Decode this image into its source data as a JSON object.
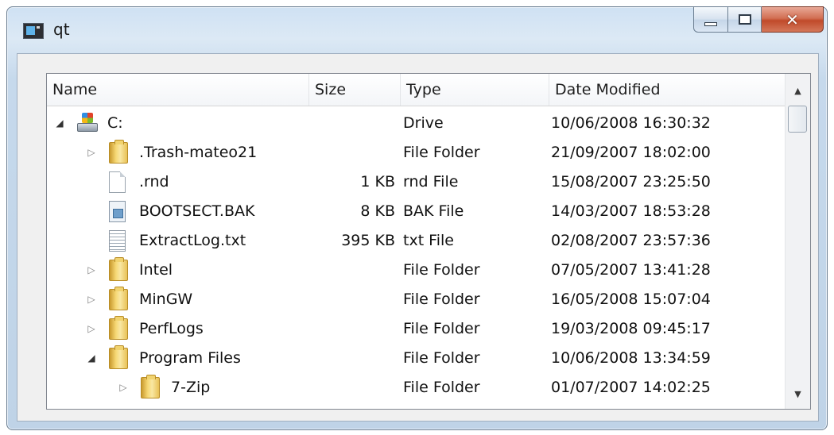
{
  "window": {
    "title": "qt"
  },
  "columns": [
    "Name",
    "Size",
    "Type",
    "Date Modified"
  ],
  "rows": [
    {
      "name": "C:",
      "size": "",
      "type": "Drive",
      "date": "10/06/2008 16:30:32",
      "level": 0,
      "expander": "expanded",
      "icon": "drive-icon"
    },
    {
      "name": ".Trash-mateo21",
      "size": "",
      "type": "File Folder",
      "date": "21/09/2007 18:02:00",
      "level": 1,
      "expander": "collapsed",
      "icon": "folder-icon"
    },
    {
      "name": ".rnd",
      "size": "1 KB",
      "type": "rnd File",
      "date": "15/08/2007 23:25:50",
      "level": 1,
      "expander": "none",
      "icon": "file-icon"
    },
    {
      "name": "BOOTSECT.BAK",
      "size": "8 KB",
      "type": "BAK File",
      "date": "14/03/2007 18:53:28",
      "level": 1,
      "expander": "none",
      "icon": "bak-file-icon"
    },
    {
      "name": "ExtractLog.txt",
      "size": "395 KB",
      "type": "txt File",
      "date": "02/08/2007 23:57:36",
      "level": 1,
      "expander": "none",
      "icon": "text-file-icon"
    },
    {
      "name": "Intel",
      "size": "",
      "type": "File Folder",
      "date": "07/05/2007 13:41:28",
      "level": 1,
      "expander": "collapsed",
      "icon": "folder-icon"
    },
    {
      "name": "MinGW",
      "size": "",
      "type": "File Folder",
      "date": "16/05/2008 15:07:04",
      "level": 1,
      "expander": "collapsed",
      "icon": "folder-icon"
    },
    {
      "name": "PerfLogs",
      "size": "",
      "type": "File Folder",
      "date": "19/03/2008 09:45:17",
      "level": 1,
      "expander": "collapsed",
      "icon": "folder-icon"
    },
    {
      "name": "Program Files",
      "size": "",
      "type": "File Folder",
      "date": "10/06/2008 13:34:59",
      "level": 1,
      "expander": "expanded",
      "icon": "folder-icon"
    },
    {
      "name": "7-Zip",
      "size": "",
      "type": "File Folder",
      "date": "01/07/2007 14:02:25",
      "level": 2,
      "expander": "collapsed",
      "icon": "folder-icon"
    }
  ]
}
